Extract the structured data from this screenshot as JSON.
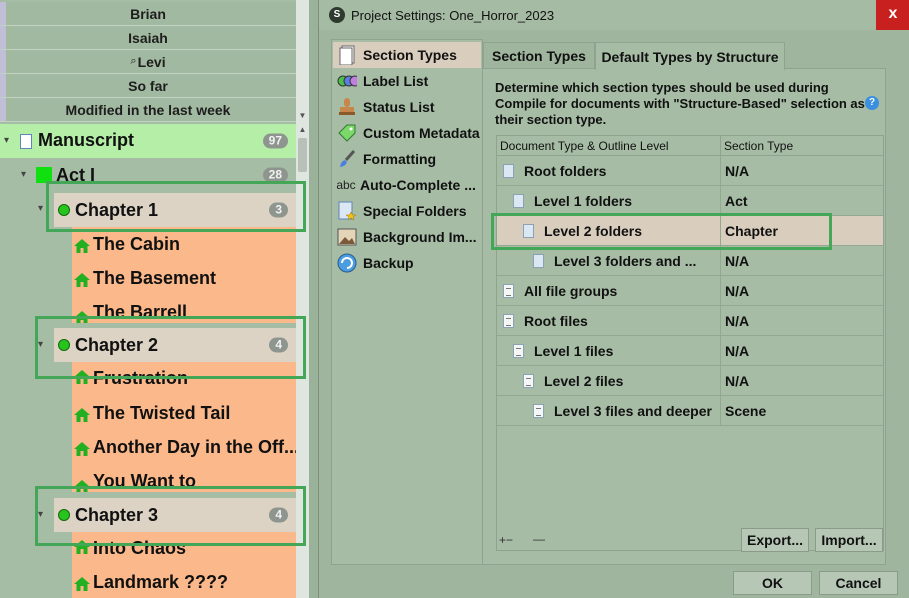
{
  "binder": {
    "collection_rows": [
      "Brian",
      "Isaiah",
      "Levi",
      "So far",
      "Modified in the last week"
    ],
    "manuscript": {
      "label": "Manuscript",
      "count": "97"
    },
    "act": {
      "label": "Act I",
      "count": "28"
    },
    "chapters": [
      {
        "label": "Chapter 1",
        "count": "3",
        "scenes": [
          "The Cabin",
          "The Basement",
          "The Barrell"
        ]
      },
      {
        "label": "Chapter 2",
        "count": "4",
        "scenes": [
          "Frustration",
          "The Twisted Tail",
          "Another Day in the Off...",
          "You Want to"
        ]
      },
      {
        "label": "Chapter 3",
        "count": "4",
        "scenes": [
          "Into Chaos",
          "Landmark ????"
        ]
      }
    ]
  },
  "dialog": {
    "title": "Project Settings: One_Horror_2023",
    "close": "x",
    "app_icon": "S",
    "sidebar": [
      {
        "label": "Section Types",
        "icon": "section-types-icon"
      },
      {
        "label": "Label List",
        "icon": "label-list-icon"
      },
      {
        "label": "Status List",
        "icon": "status-stamp-icon"
      },
      {
        "label": "Custom Metadata",
        "icon": "tag-icon"
      },
      {
        "label": "Formatting",
        "icon": "brush-icon"
      },
      {
        "label": "Auto-Complete ...",
        "icon": "abc-icon"
      },
      {
        "label": "Special Folders",
        "icon": "special-folder-icon"
      },
      {
        "label": "Background Im...",
        "icon": "image-icon"
      },
      {
        "label": "Backup",
        "icon": "backup-icon"
      }
    ],
    "tabs": [
      "Section Types",
      "Default Types by Structure"
    ],
    "description": "Determine which section types should be used during Compile for documents with \"Structure-Based\" selection as their section type.",
    "help": "?",
    "table": {
      "headers": [
        "Document Type & Outline Level",
        "Section Type"
      ],
      "rows": [
        {
          "label": "Root folders",
          "type": "N/A"
        },
        {
          "label": "Level 1 folders",
          "type": "Act"
        },
        {
          "label": "Level 2 folders",
          "type": "Chapter"
        },
        {
          "label": "Level 3 folders and ...",
          "type": "N/A"
        },
        {
          "label": "All file groups",
          "type": "N/A"
        },
        {
          "label": "Root files",
          "type": "N/A"
        },
        {
          "label": "Level 1 files",
          "type": "N/A"
        },
        {
          "label": "Level 2 files",
          "type": "N/A"
        },
        {
          "label": "Level 3 files and deeper",
          "type": "Scene"
        }
      ]
    },
    "add_label": "+−",
    "remove_label": "—",
    "export_label": "Export...",
    "import_label": "Import...",
    "ok_label": "OK",
    "cancel_label": "Cancel"
  },
  "colors": {
    "highlight": "#44a657",
    "scene": "#fbb88a",
    "selected": "#d9cdbd",
    "close": "#c8201f"
  }
}
